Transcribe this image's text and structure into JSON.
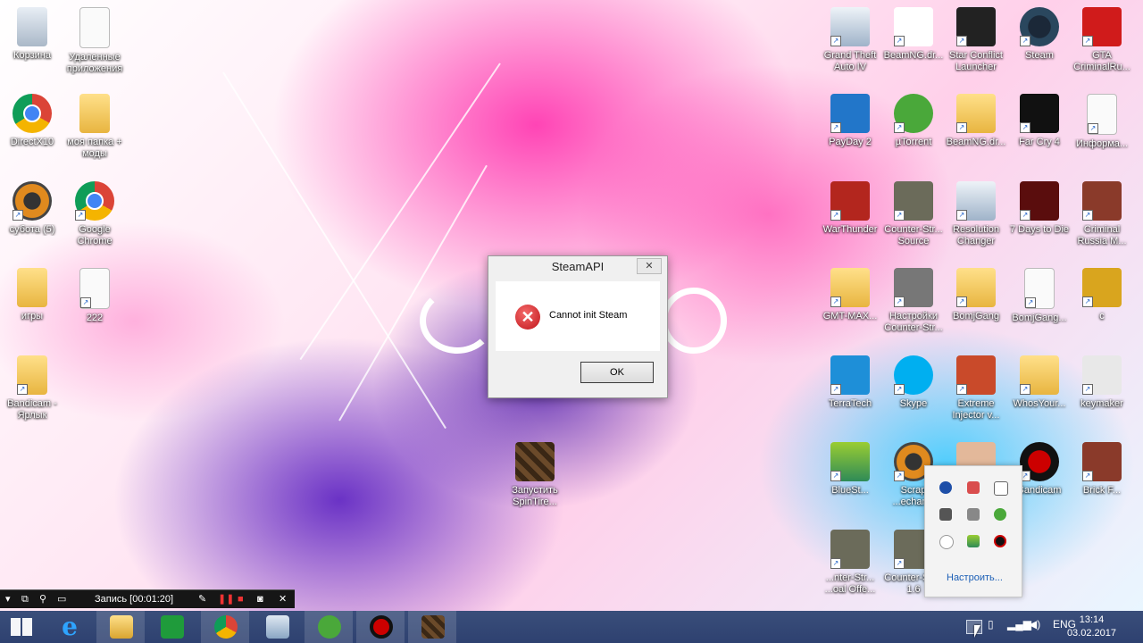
{
  "desktop": {
    "left_icons": [
      {
        "label": "Корзина",
        "icon": "recycle-bin-icon"
      },
      {
        "label": "Удаленные приложения",
        "icon": "document-icon"
      },
      {
        "label": "DirectX10",
        "icon": "chrome-icon"
      },
      {
        "label": "моя папка + моды",
        "icon": "folder-icon"
      },
      {
        "label": "субота (5)",
        "icon": "speaker-icon"
      },
      {
        "label": "Google Chrome",
        "icon": "chrome-icon"
      },
      {
        "label": "игры",
        "icon": "folder-icon"
      },
      {
        "label": "222",
        "icon": "document-icon"
      },
      {
        "label": "Bandicam - Ярлык",
        "icon": "folder-icon"
      },
      {
        "label": "Запустить SpinTire...",
        "icon": "spintires-icon"
      }
    ],
    "right_icons": [
      {
        "label": "Grand Theft Auto IV",
        "icon": "app-window-icon"
      },
      {
        "label": "BeamNG.dr...",
        "icon": "beamng-icon"
      },
      {
        "label": "Star Conflict Launcher",
        "icon": "star-conflict-icon"
      },
      {
        "label": "Steam",
        "icon": "steam-icon"
      },
      {
        "label": "GTA CriminalRu...",
        "icon": "rockstar-icon"
      },
      {
        "label": "PayDay 2",
        "icon": "payday-icon"
      },
      {
        "label": "µTorrent",
        "icon": "utorrent-icon"
      },
      {
        "label": "BeamNG.dr...",
        "icon": "folder-icon"
      },
      {
        "label": "Far Cry 4",
        "icon": "farcry-icon"
      },
      {
        "label": "Информа...",
        "icon": "document-icon"
      },
      {
        "label": "WarThunder",
        "icon": "warthunder-icon"
      },
      {
        "label": "Counter-Str... Source",
        "icon": "counter-strike-icon"
      },
      {
        "label": "Resolution Changer",
        "icon": "app-window-icon"
      },
      {
        "label": "7 Days to Die",
        "icon": "7days-icon"
      },
      {
        "label": "Criminal Russia M...",
        "icon": "game-icon"
      },
      {
        "label": "GMT-MAX...",
        "icon": "folder-icon"
      },
      {
        "label": "Настройки Counter-Str...",
        "icon": "settings-icon"
      },
      {
        "label": "BomjGang",
        "icon": "folder-icon"
      },
      {
        "label": "BomjGang...",
        "icon": "document-icon"
      },
      {
        "label": "c",
        "icon": "car-icon"
      },
      {
        "label": "TerraTech",
        "icon": "terratech-icon"
      },
      {
        "label": "Skype",
        "icon": "skype-icon"
      },
      {
        "label": "Extreme Injector v...",
        "icon": "injector-icon"
      },
      {
        "label": "WhosYour...",
        "icon": "folder-icon"
      },
      {
        "label": "keymaker",
        "icon": "hat-icon"
      },
      {
        "label": "BlueSt...",
        "icon": "bluestacks-icon"
      },
      {
        "label": "Scrap ...echanic",
        "icon": "scrap-mechanic-icon"
      },
      {
        "label": "WhosYour...",
        "icon": "faces-icon"
      },
      {
        "label": "Bandicam",
        "icon": "bandicam-icon"
      },
      {
        "label": "Brick F...",
        "icon": "game-icon"
      },
      {
        "label": "...nter-Str... ...oal Offe...",
        "icon": "counter-strike-icon"
      },
      {
        "label": "Counter-Str... 1.6",
        "icon": "counter-strike-icon"
      }
    ]
  },
  "dialog": {
    "title": "SteamAPI",
    "close_glyph": "✕",
    "error_glyph": "✕",
    "message": "Cannot init Steam",
    "ok_label": "OK"
  },
  "recorder": {
    "status": "Запись [00:01:20]",
    "close_glyph": "✕"
  },
  "tray_popup": {
    "customize_label": "Настроить..."
  },
  "taskbar": {
    "language": "ENG",
    "time": "13:14",
    "date": "03.02.2017",
    "apps": [
      "windows-start-icon",
      "internet-explorer-icon",
      "file-explorer-icon",
      "store-icon",
      "chrome-icon",
      "image-viewer-icon",
      "utorrent-icon",
      "bandicam-icon",
      "spintires-icon"
    ]
  },
  "colors": {
    "taskbar": "#2e4170",
    "dialog_bg": "#f0f0f0",
    "error_red": "#c0141a",
    "link_blue": "#1c5fb6"
  }
}
